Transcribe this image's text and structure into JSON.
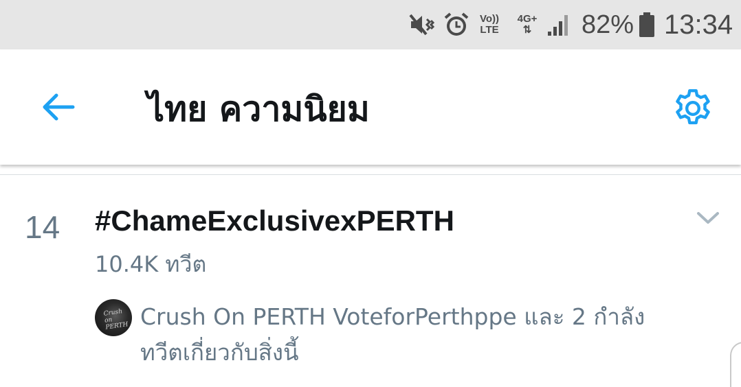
{
  "status_bar": {
    "volte_line1": "Vo))",
    "volte_line2": "LTE",
    "network_line1": "4G+",
    "network_line2": "⇅",
    "battery_percent": "82%",
    "time": "13:34",
    "icons": [
      "mute-vibrate-icon",
      "alarm-icon",
      "volte-icon",
      "network-4g-icon",
      "signal-icon",
      "battery-icon"
    ]
  },
  "header": {
    "title": "ไทย ความนิยม",
    "back_icon": "arrow-left-icon",
    "settings_icon": "gear-icon",
    "accent_color": "#1da1f2"
  },
  "trend": {
    "rank": "14",
    "name": "#ChameExclusivexPERTH",
    "tweet_count": "10.4K ทวีต",
    "context": "Crush On PERTH VoteforPerthppe และ 2 กำลังทวีตเกี่ยวกับสิ่งนี้",
    "avatar_text": "Crush on PERTH",
    "chevron_icon": "chevron-down-icon"
  }
}
